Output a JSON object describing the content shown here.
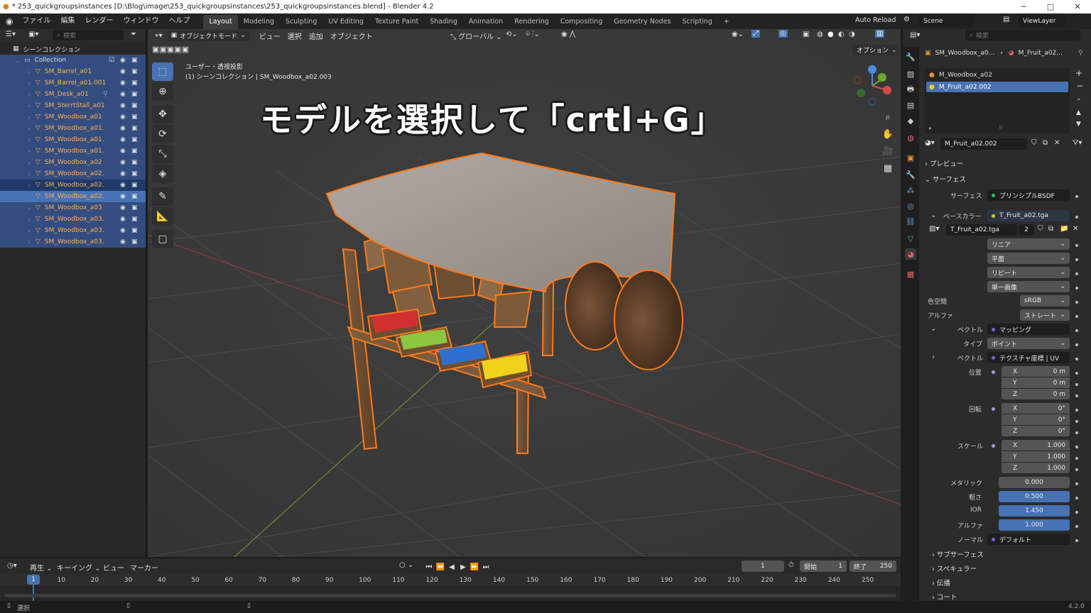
{
  "window": {
    "title": "* 253_quickgroupsinstances [D:\\Blog\\image\\253_quickgroupsinstances\\253_quickgroupsinstances.blend] - Blender 4.2",
    "version": "4.2.0"
  },
  "menus": [
    "ファイル",
    "編集",
    "レンダー",
    "ウィンドウ",
    "ヘルプ"
  ],
  "workspaces": [
    "Layout",
    "Modeling",
    "Sculpting",
    "UV Editing",
    "Texture Paint",
    "Shading",
    "Animation",
    "Rendering",
    "Compositing",
    "Geometry Nodes",
    "Scripting"
  ],
  "topright": {
    "auto_reload": "Auto Reload",
    "scene": "Scene",
    "view_layer": "ViewLayer"
  },
  "outliner": {
    "search_placeholder": "検索",
    "scene_collection": "シーンコレクション",
    "collection": "Collection",
    "items": [
      "SM_Barrel_a01",
      "SM_Barrel_a01.001",
      "SM_Desk_a01",
      "SM_SterrtStall_a01",
      "SM_Woodbox_a01",
      "SM_Woodbox_a01.",
      "SM_Woodbox_a01.",
      "SM_Woodbox_a01.",
      "SM_Woodbox_a02",
      "SM_Woodbox_a02.",
      "SM_Woodbox_a02.",
      "SM_Woodbox_a02.",
      "SM_Woodbox_a03",
      "SM_Woodbox_a03.",
      "SM_Woodbox_a03.",
      "SM_Woodbox_a03."
    ]
  },
  "viewport": {
    "mode": "オブジェクトモード",
    "menus": [
      "ビュー",
      "選択",
      "追加",
      "オブジェクト"
    ],
    "transform": "グローバル",
    "options": "オプション",
    "view_label": "ユーザー・透視投影",
    "context": "(1) シーンコレクション | SM_Woodbox_a02.003",
    "caption": "モデルを選択して「crtl+G」",
    "gizmo": {
      "x": "X",
      "y": "Y",
      "z": "Z"
    }
  },
  "properties": {
    "search_placeholder": "検索",
    "breadcrumb_object": "SM_Woodbox_a0...",
    "breadcrumb_material": "M_Fruit_a02...",
    "slots": [
      "M_Woodbox_a02",
      "M_Fruit_a02.002"
    ],
    "material_name": "M_Fruit_a02.002",
    "preview": "プレビュー",
    "surface_section": "サーフェス",
    "surface_label": "サーフェス",
    "surface_value": "プリンシプルBSDF",
    "base_color_label": "ベースカラー",
    "base_color_value": "T_Fruit_a02.tga",
    "image_name": "T_Fruit_a02.tga",
    "image_users": "2",
    "interp": "リニア",
    "projection": "平面",
    "extension": "リピート",
    "source": "単一画像",
    "colorspace_label": "色空間",
    "colorspace_value": "sRGB",
    "alpha_label": "アルファ",
    "alpha_value": "ストレート",
    "vector_label": "ベクトル",
    "vector_value": "マッピング",
    "type_label": "タイプ",
    "type_value": "ポイント",
    "vector2_label": "ベクトル",
    "vector2_value": "テクスチャ座標 | UV",
    "location_label": "位置",
    "loc": [
      "0 m",
      "0 m",
      "0 m"
    ],
    "rotation_label": "回転",
    "rot": [
      "0°",
      "0°",
      "0°"
    ],
    "scale_label": "スケール",
    "scl": [
      "1.000",
      "1.000",
      "1.000"
    ],
    "axes": [
      "X",
      "Y",
      "Z"
    ],
    "metallic_label": "メタリック",
    "metallic": "0.000",
    "roughness_label": "粗さ",
    "roughness": "0.500",
    "ior_label": "IOR",
    "ior": "1.450",
    "alpha2_label": "アルファ",
    "alpha2": "1.000",
    "normal_label": "ノーマル",
    "normal": "デフォルト",
    "subsections": [
      "サブサーフェス",
      "スペキュラー",
      "伝播",
      "コート"
    ]
  },
  "timeline": {
    "menus": [
      "再生",
      "キーイング",
      "ビュー",
      "マーカー"
    ],
    "current_frame": "1",
    "start_label": "開始",
    "start": "1",
    "end_label": "終了",
    "end": "250",
    "ticks": [
      "1",
      "10",
      "20",
      "30",
      "40",
      "50",
      "60",
      "70",
      "80",
      "90",
      "100",
      "110",
      "120",
      "130",
      "140",
      "150",
      "160",
      "170",
      "180",
      "190",
      "200",
      "210",
      "220",
      "230",
      "240",
      "250"
    ]
  },
  "status": {
    "select": "選択"
  },
  "colors": {
    "accent": "#4772b3",
    "selected_text": "#ffae52",
    "active_outline": "#ff7a1a"
  }
}
